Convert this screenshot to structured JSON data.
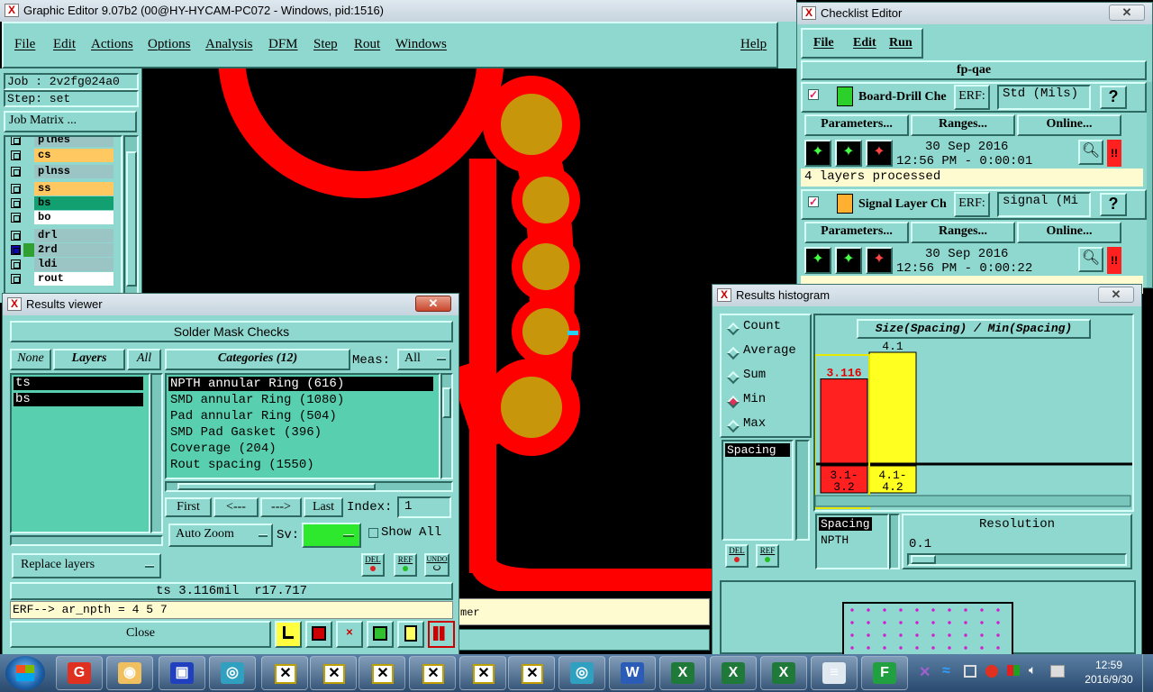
{
  "main_window": {
    "title": "Graphic Editor 9.07b2 (00@HY-HYCAM-PC072 - Windows, pid:1516)",
    "menu": [
      "File",
      "Edit",
      "Actions",
      "Options",
      "Analysis",
      "DFM",
      "Step",
      "Rout",
      "Windows"
    ],
    "help": "Help",
    "job": "Job : 2v2fg024a0",
    "step": "Step: set",
    "job_matrix": "Job Matrix ...",
    "layers": [
      {
        "name": "plnes",
        "color": "#9bc4c4"
      },
      {
        "name": "cs",
        "color": "#ffc860"
      },
      {
        "name": "plnss",
        "color": "#9bc4c4"
      },
      {
        "name": "ss",
        "color": "#ffc860"
      },
      {
        "name": "bs",
        "color": "#12a070"
      },
      {
        "name": "bo",
        "color": "#ffffff"
      },
      {
        "name": "drl",
        "color": "#9bc4c4"
      },
      {
        "name": "2rd",
        "color": "#9bc4c4"
      },
      {
        "name": "ldi",
        "color": "#9bc4c4"
      },
      {
        "name": "rout",
        "color": "#ffffff"
      }
    ],
    "status_partial": "mer"
  },
  "checklist": {
    "title": "Checklist Editor",
    "menu": [
      "File",
      "Edit",
      "Run"
    ],
    "name": "fp-qae",
    "items": [
      {
        "name": "Board-Drill Che",
        "erf_label": "ERF:",
        "erf_value": "Std (Mils)",
        "help": "?",
        "params": "Parameters...",
        "ranges": "Ranges...",
        "online": "Online...",
        "date": "30 Sep 2016",
        "time": "12:56 PM - 0:00:01",
        "status": "4 layers processed",
        "icon_color": "#2bd02b"
      },
      {
        "name": "Signal Layer Ch",
        "erf_label": "ERF:",
        "erf_value": "signal (Mi",
        "help": "?",
        "params": "Parameters...",
        "ranges": "Ranges...",
        "online": "Online...",
        "date": "30 Sep 2016",
        "time": "12:56 PM - 0:00:22",
        "status": "",
        "icon_color": "#ffb030"
      }
    ],
    "alert": "!!"
  },
  "results_viewer": {
    "title": "Results viewer",
    "header": "Solder Mask Checks",
    "none_btn": "None",
    "layers_btn": "Layers",
    "all_btn": "All",
    "layers": [
      "ts",
      "bs"
    ],
    "categories_label": "Categories (12)",
    "meas_label": "Meas:",
    "meas_value": "All",
    "categories": [
      "NPTH annular Ring (616)",
      "SMD annular Ring (1080)",
      "Pad annular Ring (504)",
      "SMD Pad Gasket (396)",
      "Coverage (204)",
      "Rout spacing (1550)"
    ],
    "first": "First",
    "prev": "<---",
    "next": "--->",
    "last": "Last",
    "index_label": "Index:",
    "index_value": "1",
    "auto_zoom": "Auto Zoom",
    "sv_label": "Sv:",
    "show_all": "Show All",
    "replace_layers": "Replace layers",
    "del": "DEL",
    "ref": "REF",
    "undo": "UNDO",
    "measure": "ts 3.116mil  r17.717",
    "erf": "ERF--> ar_npth = 4 5 7",
    "close": "Close"
  },
  "histogram": {
    "title": "Results histogram",
    "options": [
      {
        "label": "Count",
        "selected": false
      },
      {
        "label": "Average",
        "selected": false
      },
      {
        "label": "Sum",
        "selected": false
      },
      {
        "label": "Min",
        "selected": true
      },
      {
        "label": "Max",
        "selected": false
      }
    ],
    "list_item": "Spacing",
    "del": "DEL",
    "ref": "REF",
    "chart_title": "Size(Spacing) / Min(Spacing)",
    "legend_items": [
      "Spacing",
      "NPTH"
    ],
    "resolution_label": "Resolution",
    "resolution_value": "0.1",
    "colors": {
      "bar1": "#ff2020",
      "bar2": "#ffff20",
      "highlight": "#e8e800"
    }
  },
  "chart_data": {
    "type": "bar",
    "title": "Size(Spacing) / Min(Spacing)",
    "categories": [
      "3.1-\n3.2",
      "4.1-\n4.2"
    ],
    "category_lines": [
      [
        "3.1-",
        "3.2"
      ],
      [
        "4.1-",
        "4.2"
      ]
    ],
    "values": [
      3.116,
      4.1
    ],
    "value_labels": [
      "3.116",
      "4.1"
    ],
    "ylim": [
      0,
      4.4
    ]
  },
  "taskbar": {
    "time": "12:59",
    "date": "2016/9/30"
  }
}
